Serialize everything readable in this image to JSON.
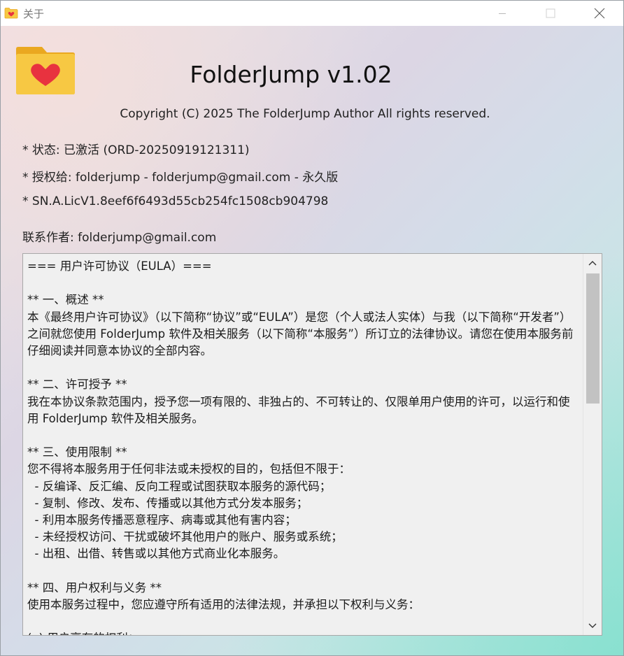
{
  "window": {
    "title": "关于",
    "icon": "folder-heart-icon"
  },
  "app": {
    "icon": "folder-heart-icon",
    "name": "FolderJump v1.02",
    "copyright": "Copyright (C) 2025 The FolderJump Author All rights reserved."
  },
  "license": {
    "status": "* 状态: 已激活 (ORD-20250919121311)",
    "licensed_to": "* 授权给: folderjump - folderjump@gmail.com - 永久版",
    "serial": "* SN.A.LicV1.8eef6f6493d55cb254fc1508cb904798"
  },
  "contact": "联系作者: folderjump@gmail.com",
  "eula": {
    "text": "=== 用户许可协议（EULA）===\n\n** 一、概述 **\n本《最终用户许可协议》（以下简称“协议”或“EULA”）是您（个人或法人实体）与我（以下简称“开发者”）之间就您使用 FolderJump 软件及相关服务（以下简称“本服务”）所订立的法律协议。请您在使用本服务前仔细阅读并同意本协议的全部内容。\n\n** 二、许可授予 **\n我在本协议条款范围内，授予您一项有限的、非独占的、不可转让的、仅限单用户使用的许可，以运行和使用 FolderJump 软件及相关服务。\n\n** 三、使用限制 **\n您不得将本服务用于任何非法或未授权的目的，包括但不限于：\n  - 反编译、反汇编、反向工程或试图获取本服务的源代码；\n  - 复制、修改、发布、传播或以其他方式分发本服务；\n  - 利用本服务传播恶意程序、病毒或其他有害内容；\n  - 未经授权访问、干扰或破坏其他用户的账户、服务或系统；\n  - 出租、出借、转售或以其他方式商业化本服务。\n\n** 四、用户权利与义务 **\n使用本服务过程中，您应遵守所有适用的法律法规，并承担以下权利与义务：\n\n(a) 用户享有的权利："
  },
  "colors": {
    "folder": "#f7c843",
    "folder_tab": "#eaa820",
    "heart": "#e8323f"
  }
}
